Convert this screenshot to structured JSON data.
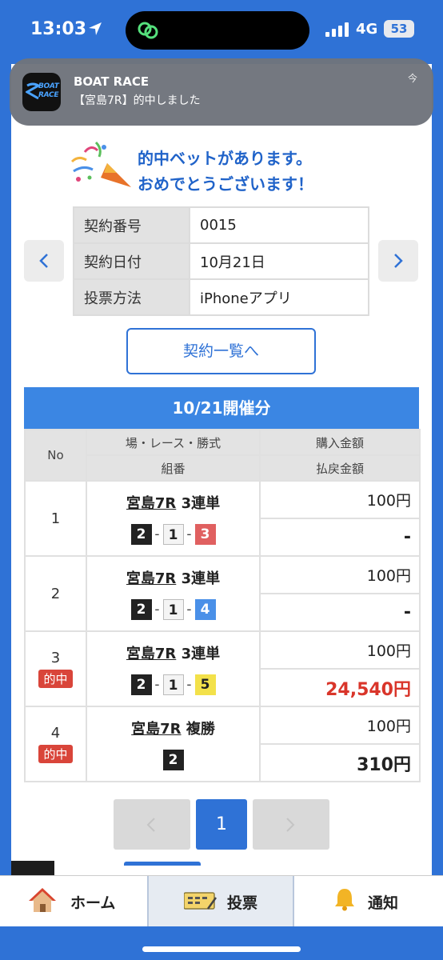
{
  "status_bar": {
    "time": "13:03",
    "network": "4G",
    "battery": "53"
  },
  "notification": {
    "app_name": "BOAT RACE",
    "logo_text": "BOAT RACE",
    "message": "【宮島7R】的中しました",
    "time": "今"
  },
  "congrats": {
    "line1": "的中ベットがあります。",
    "line2": "おめでとうございます！"
  },
  "contract": {
    "rows": [
      {
        "label": "契約番号",
        "value": "0015"
      },
      {
        "label": "契約日付",
        "value": "10月21日"
      },
      {
        "label": "投票方法",
        "value": "iPhoneアプリ"
      }
    ]
  },
  "list_button": "契約一覧へ",
  "session_header": "10/21開催分",
  "results": {
    "headers": {
      "no": "No",
      "race": "場・レース・勝式",
      "combo": "組番",
      "purchase": "購入金額",
      "payout": "払戻金額"
    },
    "rows": [
      {
        "no": "1",
        "hit": "",
        "venue": "宮島7R",
        "bet_type": "3連単",
        "combo": [
          "2",
          "1",
          "3"
        ],
        "purchase": "100円",
        "payout": "-"
      },
      {
        "no": "2",
        "hit": "",
        "venue": "宮島7R",
        "bet_type": "3連単",
        "combo": [
          "2",
          "1",
          "4"
        ],
        "purchase": "100円",
        "payout": "-"
      },
      {
        "no": "3",
        "hit": "的中",
        "venue": "宮島7R",
        "bet_type": "3連単",
        "combo": [
          "2",
          "1",
          "5"
        ],
        "purchase": "100円",
        "payout": "24,540円"
      },
      {
        "no": "4",
        "hit": "的中",
        "venue": "宮島7R",
        "bet_type": "複勝",
        "combo": [
          "2"
        ],
        "purchase": "100円",
        "payout": "310円"
      }
    ]
  },
  "pagination": {
    "current": "1"
  },
  "tab_bar": {
    "home": "ホーム",
    "vote": "投票",
    "notify": "通知"
  },
  "icons": {
    "home": "home-icon",
    "vote": "ticket-icon",
    "notify": "bell-icon",
    "party": "party-popper-icon"
  },
  "colors": {
    "brand_blue": "#2f72d6",
    "hit_red": "#d9453a"
  }
}
